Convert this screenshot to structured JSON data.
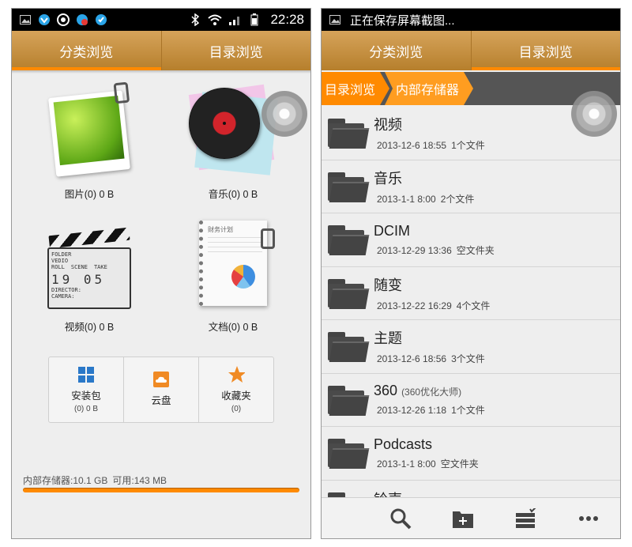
{
  "status_left": {
    "time": "22:28"
  },
  "status_right": {
    "notice": "正在保存屏幕截图..."
  },
  "tabs": [
    {
      "label": "分类浏览"
    },
    {
      "label": "目录浏览"
    }
  ],
  "categories": [
    {
      "label": "图片(0) 0 B",
      "icon": "image-icon"
    },
    {
      "label": "音乐(0) 0 B",
      "icon": "music-icon"
    },
    {
      "label": "视频(0) 0 B",
      "icon": "video-icon"
    },
    {
      "label": "文档(0) 0 B",
      "icon": "document-icon"
    }
  ],
  "art_text": {
    "clapper_title": "FOLDER",
    "clapper_line1": "VEDIO",
    "clapper_roll": "ROLL",
    "clapper_scene": "SCENE",
    "clapper_take": "TAKE",
    "clapper_nums": "19 05",
    "clapper_director": "DIRECTOR:",
    "clapper_camera": "CAMERA:",
    "notebook_title": "财务计划"
  },
  "quick": [
    {
      "label": "安装包",
      "sub": "(0) 0 B",
      "icon": "apps-icon"
    },
    {
      "label": "云盘",
      "sub": "",
      "icon": "cloud-icon"
    },
    {
      "label": "收藏夹",
      "sub": "(0)",
      "icon": "star-icon"
    }
  ],
  "storage": {
    "text": "内部存储器:10.1 GB",
    "available": "可用:143 MB",
    "used_fraction": 0.99
  },
  "breadcrumb": [
    {
      "label": "目录浏览"
    },
    {
      "label": "内部存储器"
    }
  ],
  "folders": [
    {
      "name": "视频",
      "extra": "",
      "date": "2013-12-6 18:55",
      "count": "1个文件"
    },
    {
      "name": "音乐",
      "extra": "",
      "date": "2013-1-1 8:00",
      "count": "2个文件"
    },
    {
      "name": "DCIM",
      "extra": "",
      "date": "2013-12-29 13:36",
      "count": "空文件夹"
    },
    {
      "name": "随变",
      "extra": "",
      "date": "2013-12-22 16:29",
      "count": "4个文件"
    },
    {
      "name": "主题",
      "extra": "",
      "date": "2013-12-6 18:56",
      "count": "3个文件"
    },
    {
      "name": "360",
      "extra": "(360优化大师)",
      "date": "2013-12-26 1:18",
      "count": "1个文件"
    },
    {
      "name": "Podcasts",
      "extra": "",
      "date": "2013-1-1 8:00",
      "count": "空文件夹"
    },
    {
      "name": "铃声",
      "extra": "",
      "date": "",
      "count": ""
    }
  ],
  "bottom_icons": [
    "search-icon",
    "new-folder-icon",
    "batch-select-icon",
    "more-icon"
  ]
}
